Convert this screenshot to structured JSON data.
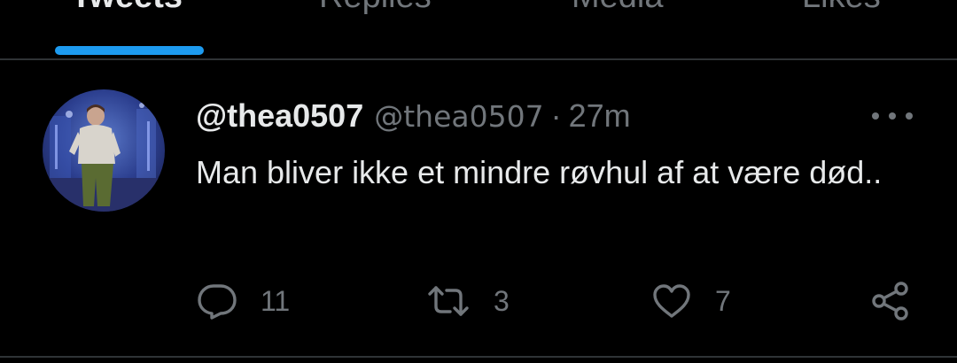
{
  "tabs": [
    {
      "label": "Tweets",
      "active": true
    },
    {
      "label": "Replies",
      "active": false
    },
    {
      "label": "Media",
      "active": false
    },
    {
      "label": "Likes",
      "active": false
    }
  ],
  "tweet": {
    "display_name": "@thea0507",
    "handle": "@thea0507",
    "separator": "·",
    "time": "27m",
    "text": "Man bliver ikke et mindre røvhul af at være død..",
    "avatar": "avatar-photo",
    "actions": {
      "reply": {
        "icon": "reply-icon",
        "count": "11"
      },
      "retweet": {
        "icon": "retweet-icon",
        "count": "3"
      },
      "like": {
        "icon": "heart-icon",
        "count": "7"
      },
      "share": {
        "icon": "share-icon"
      }
    }
  },
  "colors": {
    "background": "#000000",
    "primary_text": "#e7e9ea",
    "secondary_text": "#71767b",
    "accent": "#1d9bf0",
    "divider": "#2f3336"
  }
}
